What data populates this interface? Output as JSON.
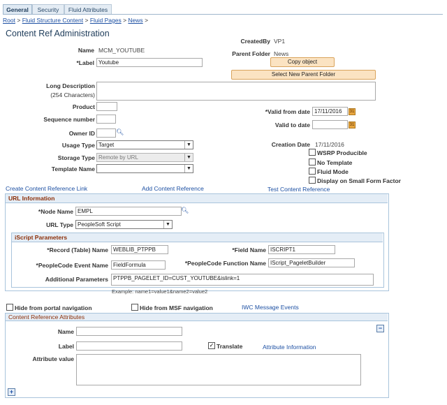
{
  "tabs": [
    "General",
    "Security",
    "Fluid Attributes"
  ],
  "breadcrumb": [
    "Root",
    "Fluid Structure Content",
    "Fluid Pages",
    "News"
  ],
  "breadcrumb_sep": ">",
  "page_title": "Content Ref Administration",
  "created_by": {
    "label": "CreatedBy",
    "value": "VP1"
  },
  "name": {
    "label": "Name",
    "value": "MCM_YOUTUBE"
  },
  "parent_folder": {
    "label": "Parent Folder",
    "value": "News"
  },
  "label_field": {
    "label": "*Label",
    "value": "Youtube"
  },
  "copy_object": "Copy object",
  "select_parent": "Select New Parent Folder",
  "long_description": {
    "label": "Long Description",
    "sub": "(254 Characters)",
    "value": ""
  },
  "product": {
    "label": "Product",
    "value": ""
  },
  "sequence_number": {
    "label": "Sequence number",
    "value": ""
  },
  "valid_from": {
    "label": "*Valid from date",
    "value": "17/11/2016"
  },
  "valid_to": {
    "label": "Valid to date",
    "value": ""
  },
  "owner_id": {
    "label": "Owner ID",
    "value": ""
  },
  "usage_type": {
    "label": "Usage Type",
    "value": "Target"
  },
  "creation_date": {
    "label": "Creation Date",
    "value": "17/11/2016"
  },
  "storage_type": {
    "label": "Storage Type",
    "value": "Remote by URL"
  },
  "template_name": {
    "label": "Template Name",
    "value": ""
  },
  "checkboxes": {
    "wsrp": "WSRP Producible",
    "no_template": "No Template",
    "fluid_mode": "Fluid Mode",
    "small_form": "Display on Small Form Factor"
  },
  "links": {
    "create": "Create Content Reference Link",
    "add": "Add Content Reference",
    "test": "Test Content Reference"
  },
  "url_info": {
    "title": "URL Information",
    "node_name": {
      "label": "*Node Name",
      "value": "EMPL"
    },
    "url_type": {
      "label": "URL Type",
      "value": "PeopleSoft Script"
    }
  },
  "iscript": {
    "title": "iScript Parameters",
    "record": {
      "label": "*Record (Table) Name",
      "value": "WEBLIB_PTPPB"
    },
    "field": {
      "label": "*Field Name",
      "value": "ISCRIPT1"
    },
    "event": {
      "label": "*PeopleCode Event Name",
      "value": "FieldFormula"
    },
    "function": {
      "label": "*PeopleCode Function Name",
      "value": "IScript_PageletBuilder"
    },
    "additional": {
      "label": "Additional Parameters",
      "value": "PTPPB_PAGELET_ID=CUST_YOUTUBE&islink=1"
    },
    "example": "Example: name1=value1&name2=value2"
  },
  "hide_portal": "Hide from portal navigation",
  "hide_msf": "Hide from MSF navigation",
  "iwc": "IWC Message Events",
  "cref_attr": {
    "title": "Content Reference Attributes",
    "name": {
      "label": "Name",
      "value": ""
    },
    "label": {
      "label": "Label",
      "value": ""
    },
    "translate": "Translate",
    "attr_info": "Attribute Information",
    "attr_value": {
      "label": "Attribute value",
      "value": ""
    },
    "collapse": "−",
    "add": "+"
  }
}
